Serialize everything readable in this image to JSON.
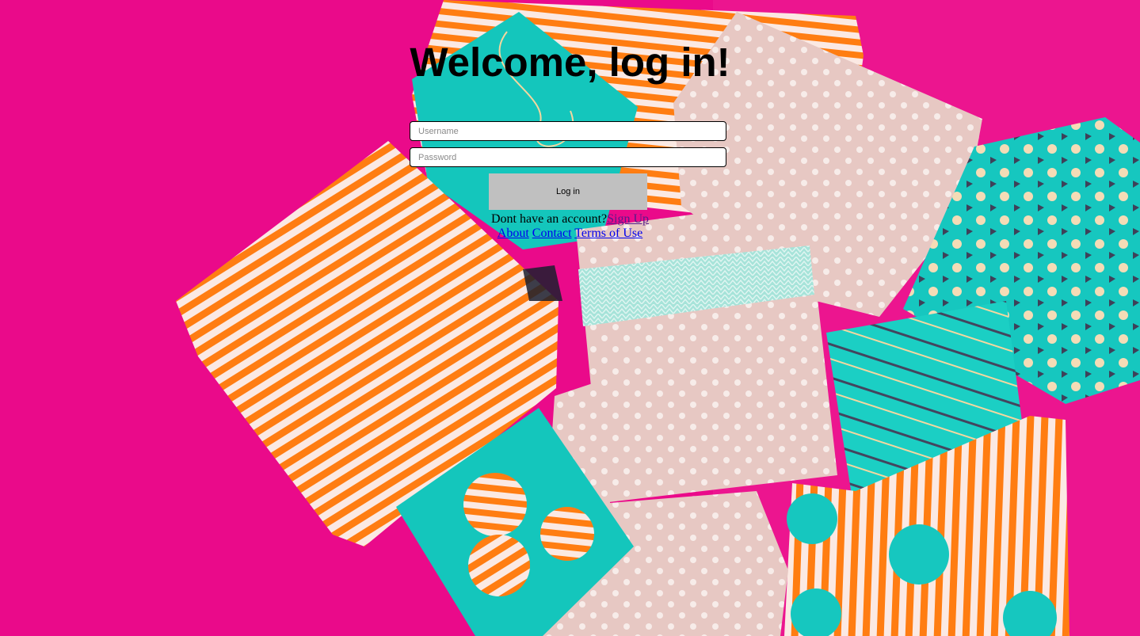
{
  "page": {
    "title": "Welcome, log in!"
  },
  "form": {
    "username_placeholder": "Username",
    "password_placeholder": "Password",
    "login_label": "Log in"
  },
  "signup": {
    "prompt": "Dont have an account?",
    "link_label": "Sign Up"
  },
  "footer": {
    "links": [
      "About",
      "Contact",
      "Terms of Use"
    ]
  },
  "colors": {
    "background": "#ea0a8a",
    "stripe_orange": "#ff7d12",
    "gift_pink": "#e8c7c2",
    "gift_teal": "#12cbc1",
    "button": "#c0c0c0"
  }
}
